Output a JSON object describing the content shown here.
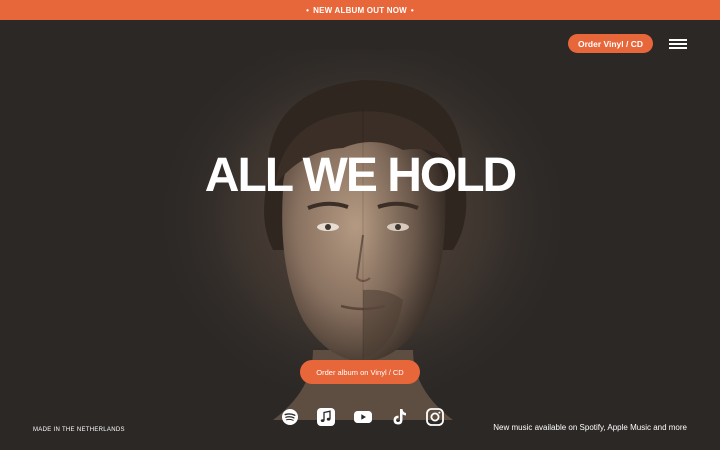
{
  "announcement": {
    "text": "NEW ALBUM OUT NOW",
    "bullet": "•"
  },
  "header": {
    "order_label": "Order Vinyl / CD",
    "menu_icon": "hamburger-menu-icon"
  },
  "hero": {
    "title": "ALL WE HOLD",
    "image_icon": "album-portrait-image"
  },
  "cta": {
    "label": "Order album on Vinyl / CD"
  },
  "socials": [
    "spotify-icon",
    "apple-music-icon",
    "youtube-icon",
    "tiktok-icon",
    "instagram-icon"
  ],
  "footer": {
    "left": "MADE IN THE NETHERLANDS",
    "right": "New music available on Spotify, Apple Music and more"
  },
  "colors": {
    "accent": "#e8673a",
    "background": "#2b2826",
    "text": "#ffffff"
  }
}
